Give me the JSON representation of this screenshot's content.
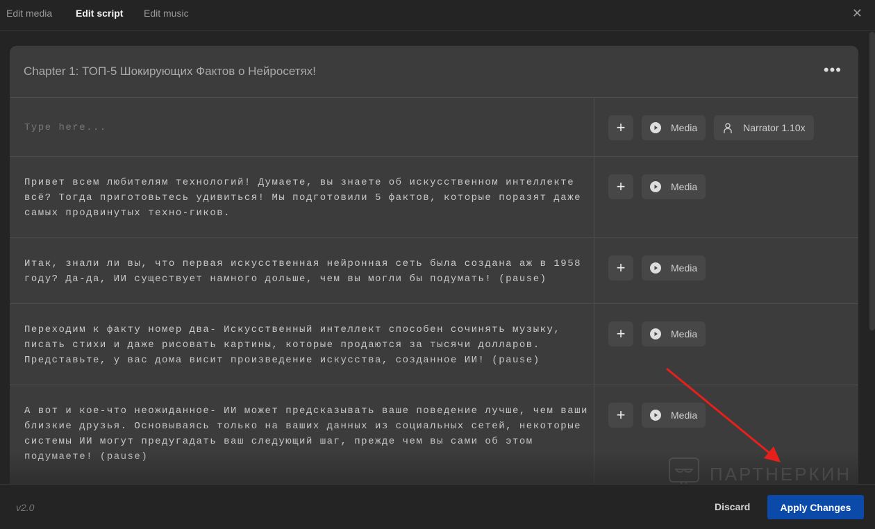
{
  "tabs": [
    "Edit media",
    "Edit script",
    "Edit music"
  ],
  "chapter_title": "Chapter 1: ТОП-5 Шокирующих Фактов о Нейросетях!",
  "placeholder": "Type here...",
  "media_label": "Media",
  "narrator_label": "Narrator 1.10x",
  "paragraphs": [
    "Привет всем любителям технологий! Думаете, вы знаете об искусственном интеллекте всё? Тогда приготовьтесь удивиться! Мы подготовили 5 фактов, которые поразят даже самых продвинутых техно-гиков.",
    "Итак, знали ли вы, что первая искусственная нейронная сеть была создана аж в 1958 году? Да-да, ИИ существует намного дольше, чем вы могли бы подумать! (pause)",
    "Переходим к факту номер два- Искусственный интеллект способен сочинять музыку, писать стихи и даже рисовать картины, которые продаются за тысячи долларов. Представьте, у вас дома висит произведение искусства, созданное ИИ! (pause)",
    "А вот и кое-что неожиданное- ИИ может предсказывать ваше поведение лучше, чем ваши близкие друзья. Основываясь только на ваших данных из социальных сетей, некоторые системы ИИ могут предугадать ваш следующий шаг, прежде чем вы сами об этом подумаете! (pause)"
  ],
  "footer": {
    "version": "v2.0",
    "discard": "Discard",
    "apply": "Apply Changes"
  },
  "watermark": "ПАРТНЕРКИН",
  "colors": {
    "accent": "#0b4aa8",
    "annotation_arrow": "#e8201c"
  }
}
